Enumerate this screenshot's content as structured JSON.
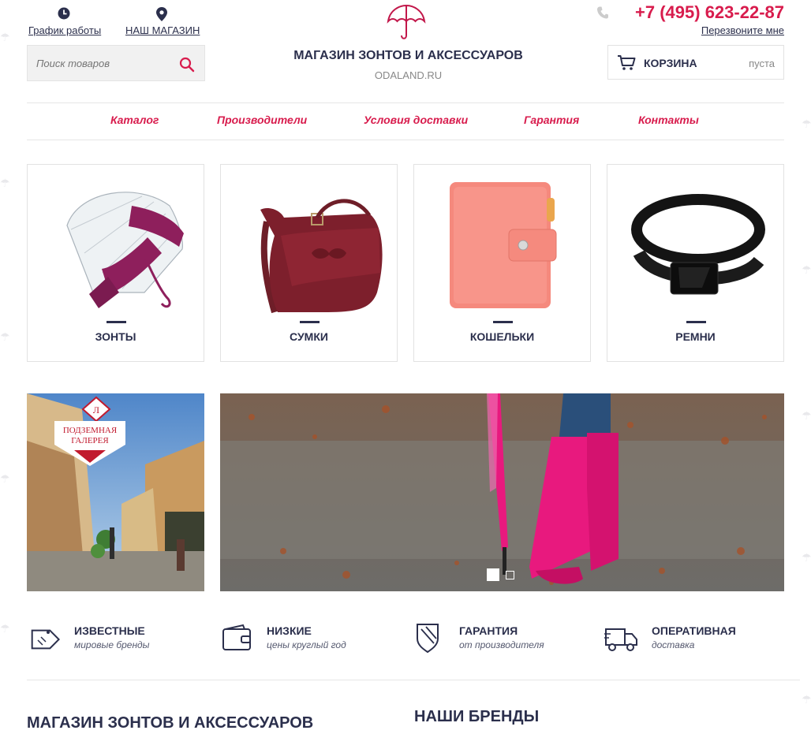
{
  "header": {
    "schedule_label": "График работы",
    "store_label": "НАШ МАГАЗИН",
    "search_placeholder": "Поиск товаров",
    "shop_title": "МАГАЗИН ЗОНТОВ И АКСЕССУАРОВ",
    "shop_domain": "ODALAND.RU",
    "phone": "+7 (495) 623-22-87",
    "callback_label": "Перезвоните мне",
    "cart_label": "КОРЗИНА",
    "cart_status": "пуста"
  },
  "nav": [
    "Каталог",
    "Производители",
    "Условия доставки",
    "Гарантия",
    "Контакты"
  ],
  "categories": [
    "ЗОНТЫ",
    "СУМКИ",
    "КОШЕЛЬКИ",
    "РЕМНИ"
  ],
  "promo": {
    "sign_line1": "ПОДЗЕМНАЯ",
    "sign_line2": "ГАЛЕРЕЯ",
    "sign_letter": "Л"
  },
  "features": [
    {
      "title": "ИЗВЕСТНЫЕ",
      "subtitle": "мировые бренды",
      "icon": "price-tag-icon"
    },
    {
      "title": "НИЗКИЕ",
      "subtitle": "цены круглый год",
      "icon": "wallet-icon"
    },
    {
      "title": "ГАРАНТИЯ",
      "subtitle": "от производителя",
      "icon": "shield-icon"
    },
    {
      "title": "ОПЕРАТИВНАЯ",
      "subtitle": "доставка",
      "icon": "truck-icon"
    }
  ],
  "sections": {
    "about_title": "МАГАЗИН ЗОНТОВ И АКСЕССУАРОВ",
    "brands_title": "НАШИ БРЕНДЫ"
  },
  "colors": {
    "accent": "#d81c4d",
    "text": "#2b2f4c",
    "pink": "#e8197e"
  }
}
